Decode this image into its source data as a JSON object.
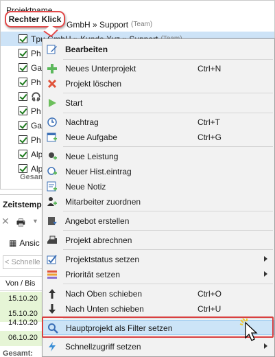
{
  "project_panel": {
    "header": "Projektname",
    "selected_row": "Tpu GmbH » Kunde Xyz » Support",
    "selected_team": "(Team)",
    "top_row": "GmbH » Support",
    "top_team": "(Team)",
    "rows": [
      "Ph",
      "Ga",
      "Ph",
      "",
      "Ph",
      "Ga",
      "Ph",
      "Alp",
      "Alp"
    ],
    "total_label": "Gesam"
  },
  "time_panel": {
    "title": "Zeitstemp",
    "view_label": "Ansic",
    "search_placeholder": "< Schnelle",
    "column_header": "Von / Bis",
    "rows": [
      "15.10.20",
      "15.10.20",
      "14.10.20",
      "06.10.20"
    ],
    "total_label": "Gesamt:"
  },
  "callout": {
    "text": "Rechter Klick",
    "color": "#e34848"
  },
  "menu": {
    "items": [
      {
        "label": "Bearbeiten",
        "icon": "edit-icon",
        "bold": true
      },
      {
        "label": "Neues Unterprojekt",
        "icon": "plus-icon",
        "shortcut": "Ctrl+N"
      },
      {
        "label": "Projekt löschen",
        "icon": "delete-icon"
      },
      {
        "label": "Start",
        "icon": "play-icon"
      },
      {
        "label": "Nachtrag",
        "icon": "clock-icon",
        "shortcut": "Ctrl+T"
      },
      {
        "label": "Neue Aufgabe",
        "icon": "task-icon",
        "shortcut": "Ctrl+G"
      },
      {
        "label": "Neue Leistung",
        "icon": "service-icon"
      },
      {
        "label": "Neuer Hist.eintrag",
        "icon": "history-icon"
      },
      {
        "label": "Neue Notiz",
        "icon": "note-icon"
      },
      {
        "label": "Mitarbeiter zuordnen",
        "icon": "user-add-icon"
      },
      {
        "label": "Angebot erstellen",
        "icon": "offer-icon"
      },
      {
        "label": "Projekt abrechnen",
        "icon": "invoice-icon"
      },
      {
        "label": "Projektstatus setzen",
        "icon": "status-icon",
        "submenu": true
      },
      {
        "label": "Priorität setzen",
        "icon": "priority-icon",
        "submenu": true
      },
      {
        "label": "Nach Oben schieben",
        "icon": "arrow-up-icon",
        "shortcut": "Ctrl+O"
      },
      {
        "label": "Nach Unten schieben",
        "icon": "arrow-down-icon",
        "shortcut": "Ctrl+U"
      },
      {
        "label": "Hauptprojekt als Filter setzen",
        "icon": "search-icon",
        "highlighted": true
      },
      {
        "label": "Schnellzugriff setzen",
        "icon": "bolt-icon",
        "submenu": true
      }
    ]
  },
  "colors": {
    "highlight_bg": "#cce4f7",
    "highlight_frame": "#d94040",
    "selection_bg": "#cde3f7",
    "row_green": "#e6f5d6"
  }
}
